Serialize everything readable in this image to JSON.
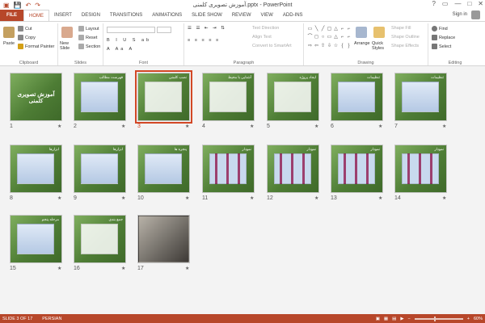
{
  "window": {
    "title": "آموزش تصویری کلمنی.pptx - PowerPoint",
    "controls": [
      "?",
      "▭",
      "—",
      "□",
      "✕"
    ]
  },
  "qat": [
    "💾",
    "↶",
    "↷",
    "▣"
  ],
  "tabs": [
    {
      "label": "FILE"
    },
    {
      "label": "HOME"
    },
    {
      "label": "INSERT"
    },
    {
      "label": "DESIGN"
    },
    {
      "label": "TRANSITIONS"
    },
    {
      "label": "ANIMATIONS"
    },
    {
      "label": "SLIDE SHOW"
    },
    {
      "label": "REVIEW"
    },
    {
      "label": "VIEW"
    },
    {
      "label": "ADD-INS"
    }
  ],
  "signin": "Sign in",
  "ribbon": {
    "clipboard": {
      "label": "Clipboard",
      "paste": "Paste",
      "cut": "Cut",
      "copy": "Copy",
      "format_painter": "Format Painter"
    },
    "slides": {
      "label": "Slides",
      "new_slide": "New Slide",
      "layout": "Layout",
      "reset": "Reset",
      "section": "Section"
    },
    "font": {
      "label": "Font"
    },
    "paragraph": {
      "label": "Paragraph",
      "text_direction": "Text Direction",
      "align_text": "Align Text",
      "convert": "Convert to SmartArt"
    },
    "drawing": {
      "label": "Drawing",
      "arrange": "Arrange",
      "quick_styles": "Quick Styles",
      "shape_fill": "Shape Fill",
      "shape_outline": "Shape Outline",
      "shape_effects": "Shape Effects"
    },
    "editing": {
      "label": "Editing",
      "find": "Find",
      "replace": "Replace",
      "select": "Select"
    }
  },
  "slides": [
    {
      "num": "1",
      "style": "title",
      "caption": "",
      "big": "آموزش تصویری کلمنی"
    },
    {
      "num": "2",
      "style": "blue",
      "caption": "فهرست مطالب",
      "big": ""
    },
    {
      "num": "3",
      "style": "white",
      "caption": "نصب کلمنی",
      "big": "",
      "selected": true
    },
    {
      "num": "4",
      "style": "white",
      "caption": "آشنایی با محیط",
      "big": ""
    },
    {
      "num": "5",
      "style": "white",
      "caption": "ایجاد پروژه",
      "big": ""
    },
    {
      "num": "6",
      "style": "blue",
      "caption": "تنظیمات",
      "big": ""
    },
    {
      "num": "7",
      "style": "blue",
      "caption": "تنظیمات",
      "big": ""
    },
    {
      "num": "8",
      "style": "blue",
      "caption": "ابزارها",
      "big": ""
    },
    {
      "num": "9",
      "style": "blue",
      "caption": "ابزارها",
      "big": ""
    },
    {
      "num": "10",
      "style": "blue",
      "caption": "پنجره ها",
      "big": ""
    },
    {
      "num": "11",
      "style": "chart",
      "caption": "نمودار",
      "big": ""
    },
    {
      "num": "12",
      "style": "chart",
      "caption": "نمودار",
      "big": ""
    },
    {
      "num": "13",
      "style": "chart",
      "caption": "نمودار",
      "big": ""
    },
    {
      "num": "14",
      "style": "chart",
      "caption": "نمودار",
      "big": ""
    },
    {
      "num": "15",
      "style": "blue",
      "caption": "مرحله پنجم",
      "big": ""
    },
    {
      "num": "16",
      "style": "white",
      "caption": "جمع بندی",
      "big": ""
    },
    {
      "num": "17",
      "style": "photo",
      "caption": "",
      "big": ""
    }
  ],
  "status": {
    "slide": "SLIDE 3 OF 17",
    "language": "PERSIAN",
    "zoom": "60%"
  }
}
